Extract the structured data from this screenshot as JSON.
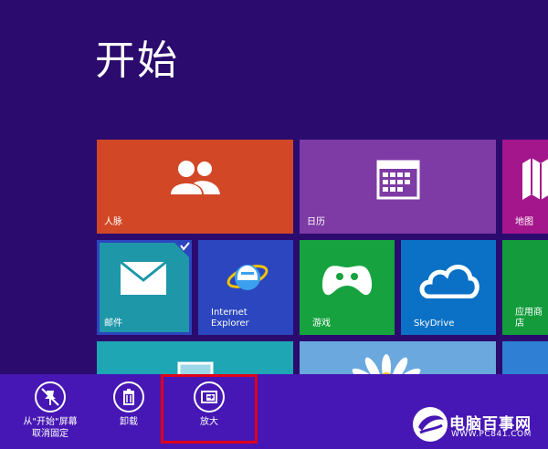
{
  "start": {
    "title": "开始"
  },
  "tiles": {
    "people": {
      "label": "人脉",
      "color": "#d24726"
    },
    "calendar": {
      "label": "日历",
      "color": "#7e3aa5"
    },
    "maps": {
      "label": "地图",
      "color": "#a4168b"
    },
    "mail": {
      "label": "邮件",
      "color": "#1e97a9",
      "selected": true
    },
    "ie": {
      "label": "Internet\nExplorer",
      "color": "#2c46bf"
    },
    "games": {
      "label": "游戏",
      "color": "#16a33f"
    },
    "skydrive": {
      "label": "SkyDrive",
      "color": "#0a71c6"
    },
    "store": {
      "label": "应用商店",
      "color": "#149c3c"
    }
  },
  "app_bar": {
    "unpin": {
      "label": "从\"开始\"屏幕\n取消固定",
      "icon": "unpin-icon"
    },
    "uninstall": {
      "label": "卸载",
      "icon": "trash-icon"
    },
    "enlarge": {
      "label": "放大",
      "icon": "resize-icon"
    }
  },
  "watermark": {
    "text": "电脑百事网",
    "url": "WWW.PC841.COM"
  }
}
